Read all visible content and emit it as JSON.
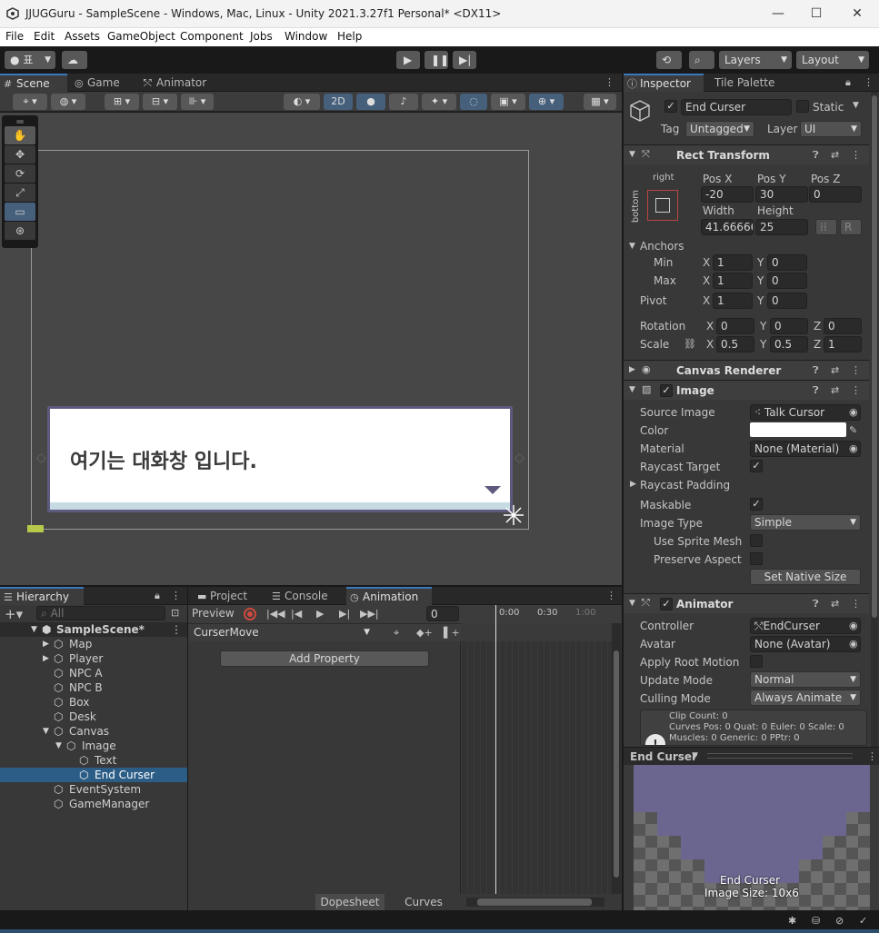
{
  "window": {
    "title": "JJUGGuru - SampleScene - Windows, Mac, Linux - Unity 2021.3.27f1 Personal* <DX11>"
  },
  "menu": [
    "File",
    "Edit",
    "Assets",
    "GameObject",
    "Component",
    "Jobs",
    "Window",
    "Help"
  ],
  "toolbar": {
    "account_label": "표",
    "layers": "Layers",
    "layout": "Layout"
  },
  "scene_tabs": [
    {
      "label": "Scene"
    },
    {
      "label": "Game"
    },
    {
      "label": "Animator"
    }
  ],
  "scene_toolbar": {
    "mode_2d": "2D"
  },
  "dialog": {
    "text": "여기는 대화창 입니다."
  },
  "inspector_tabs": [
    {
      "label": "Inspector"
    },
    {
      "label": "Tile Palette"
    }
  ],
  "object": {
    "name": "End Curser",
    "static_label": "Static",
    "tag_label": "Tag",
    "tag": "Untagged",
    "layer_label": "Layer",
    "layer": "UI"
  },
  "rect_transform": {
    "title": "Rect Transform",
    "anchor_h": "right",
    "anchor_v": "bottom",
    "posx_label": "Pos X",
    "posy_label": "Pos Y",
    "posz_label": "Pos Z",
    "posx": "-20",
    "posy": "30",
    "posz": "0",
    "width_label": "Width",
    "height_label": "Height",
    "width": "41.66666",
    "height": "25",
    "r_btn": "R",
    "anchors_label": "Anchors",
    "min_label": "Min",
    "max_label": "Max",
    "pivot_label": "Pivot",
    "min_x": "1",
    "min_y": "0",
    "max_x": "1",
    "max_y": "0",
    "pivot_x": "1",
    "pivot_y": "0",
    "rotation_label": "Rotation",
    "scale_label": "Scale",
    "rot_x": "0",
    "rot_y": "0",
    "rot_z": "0",
    "scale_x": "0.5",
    "scale_y": "0.5",
    "scale_z": "1",
    "x": "X",
    "y": "Y",
    "z": "Z"
  },
  "canvas_renderer": {
    "title": "Canvas Renderer"
  },
  "image": {
    "title": "Image",
    "source_label": "Source Image",
    "source": "Talk Cursor",
    "color_label": "Color",
    "material_label": "Material",
    "material": "None (Material)",
    "raycast_target": "Raycast Target",
    "raycast_padding": "Raycast Padding",
    "maskable": "Maskable",
    "type_label": "Image Type",
    "type": "Simple",
    "use_sprite_mesh": "Use Sprite Mesh",
    "preserve_aspect": "Preserve Aspect",
    "native_size": "Set Native Size"
  },
  "animator": {
    "title": "Animator",
    "controller_label": "Controller",
    "controller": "EndCurser",
    "avatar_label": "Avatar",
    "avatar": "None (Avatar)",
    "root_motion": "Apply Root Motion",
    "update_label": "Update Mode",
    "update": "Normal",
    "culling_label": "Culling Mode",
    "culling": "Always Animate",
    "info1": "Clip Count: 0",
    "info2": "Curves Pos: 0 Quat: 0 Euler: 0 Scale: 0",
    "info3": "Muscles: 0 Generic: 0 PPtr: 0"
  },
  "preview": {
    "title": "End Curser",
    "name": "End Curser",
    "size": "Image Size: 10x6"
  },
  "hierarchy": {
    "tab": "Hierarchy",
    "search_placeholder": "All",
    "items": [
      {
        "label": "SampleScene*"
      },
      {
        "label": "Map"
      },
      {
        "label": "Player"
      },
      {
        "label": "NPC A"
      },
      {
        "label": "NPC B"
      },
      {
        "label": "Box"
      },
      {
        "label": "Desk"
      },
      {
        "label": "Canvas"
      },
      {
        "label": "Image"
      },
      {
        "label": "Text"
      },
      {
        "label": "End Curser"
      },
      {
        "label": "EventSystem"
      },
      {
        "label": "GameManager"
      }
    ]
  },
  "bottom_tabs": [
    {
      "label": "Project"
    },
    {
      "label": "Console"
    },
    {
      "label": "Animation"
    }
  ],
  "animation": {
    "preview": "Preview",
    "frame": "0",
    "clip": "CurserMove",
    "add_property": "Add Property",
    "t0": "0:00",
    "t1": "0:30",
    "t2": "1:00",
    "dopesheet": "Dopesheet",
    "curves": "Curves"
  },
  "colors": {
    "accent": "#3a79bb",
    "selection": "#2c5d87",
    "dialog_border": "#5e5a7e",
    "preview_sprite": "#6b6690"
  }
}
